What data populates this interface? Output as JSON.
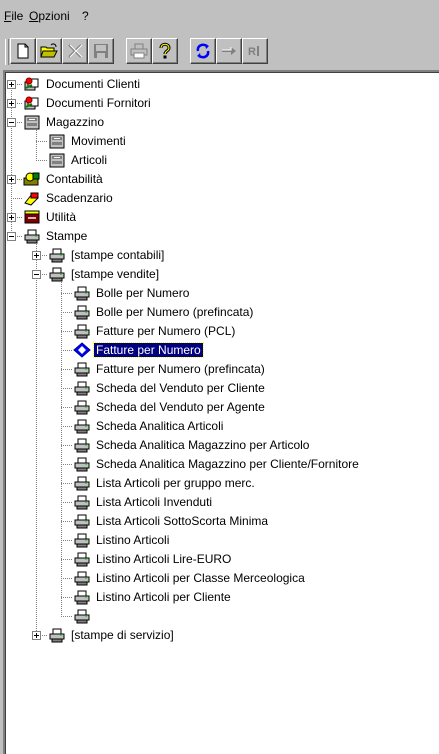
{
  "menubar": {
    "file": {
      "accel": "F",
      "rest": "ile"
    },
    "options": {
      "accel": "O",
      "rest": "pzioni"
    },
    "help": "?"
  },
  "toolbar": {
    "buttons": [
      "new-document-icon",
      "open-folder-icon",
      "delete-icon",
      "save-icon",
      "print-icon",
      "help-icon",
      "refresh-icon",
      "go-arrow-icon",
      "report-icon"
    ]
  },
  "tree": {
    "documenti_clienti": "Documenti Clienti",
    "documenti_fornitori": "Documenti Fornitori",
    "magazzino": "Magazzino",
    "movimenti": "Movimenti",
    "articoli": "Articoli",
    "contabilita": "Contabilità",
    "scadenzario": "Scadenzario",
    "utilita": "Utilità",
    "stampe": "Stampe",
    "stampe_contabili": "[stampe contabili]",
    "stampe_vendite": "[stampe vendite]",
    "vendite_items": [
      "Bolle per Numero",
      "Bolle per Numero (prefincata)",
      "Fatture per Numero (PCL)",
      "Fatture per Numero",
      "Fatture per Numero (prefincata)",
      "Scheda del Venduto per Cliente",
      "Scheda del Venduto per Agente",
      "Scheda Analitica Articoli",
      "Scheda Analitica Magazzino per Articolo",
      "Scheda Analitica Magazzino per Cliente/Fornitore",
      "Lista Articoli per gruppo merc.",
      "Lista Articoli Invenduti",
      "Lista Articoli SottoScorta Minima",
      "Listino Articoli",
      "Listino Articoli Lire-EURO",
      "Listino Articoli per Classe Merceologica",
      "Listino Articoli per Cliente",
      ""
    ],
    "selected_index": 3,
    "stampe_servizio": "[stampe di servizio]"
  }
}
